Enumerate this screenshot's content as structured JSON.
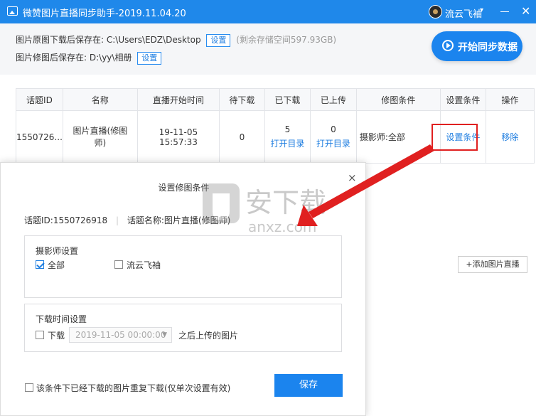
{
  "app": {
    "title": "微赞图片直播同步助手-2019.11.04.20",
    "user_name": "流云飞袖",
    "user_caret": "▾",
    "close_symbol": "✕"
  },
  "paths": {
    "original_label": "图片原图下载后保存在:",
    "original_path": "C:\\Users\\EDZ\\Desktop",
    "original_btn": "设置",
    "storage_info": "(剩余存储空间597.93GB)",
    "edited_label": "图片修图后保存在:",
    "edited_path": "D:\\yy\\相册",
    "edited_btn": "设置"
  },
  "sync_button": "开始同步数据",
  "table": {
    "headers": [
      "话题ID",
      "名称",
      "直播开始时间",
      "待下载",
      "已下载",
      "已上传",
      "修图条件",
      "设置条件",
      "操作"
    ],
    "row": {
      "topic_id": "1550726...",
      "name": "图片直播(修图师)",
      "start_date": "19-11-05",
      "start_time": "15:57:33",
      "pending": "0",
      "downloaded": "5",
      "downloaded_link": "打开目录",
      "uploaded": "0",
      "uploaded_link": "打开目录",
      "condition": "摄影师:全部",
      "set_condition": "设置条件",
      "remove": "移除"
    }
  },
  "add_live_button": "+添加图片直播",
  "modal": {
    "title": "设置修图条件",
    "close": "×",
    "topic_id_label": "话题ID:1550726918",
    "separator": "|",
    "topic_name_label": "话题名称:图片直播(修图师)",
    "photographer_section": "摄影师设置",
    "photographer_options": [
      {
        "label": "全部",
        "checked": true
      },
      {
        "label": "流云飞袖",
        "checked": false
      }
    ],
    "time_section": "下载时间设置",
    "download_label": "下载",
    "download_checked": false,
    "date_value": "2019-11-05 00:00:00",
    "date_caret": "▼",
    "after_label": "之后上传的图片",
    "redownload_label": "该条件下已经下载的图片重复下载(仅单次设置有效)",
    "save_button": "保存"
  },
  "watermark": {
    "brand": "安下载",
    "domain": "anxz.com"
  },
  "colors": {
    "titlebar": "#1f88ea",
    "primary_button": "#1b84ee",
    "link": "#1f7ee0",
    "highlight_red": "#e02020"
  }
}
